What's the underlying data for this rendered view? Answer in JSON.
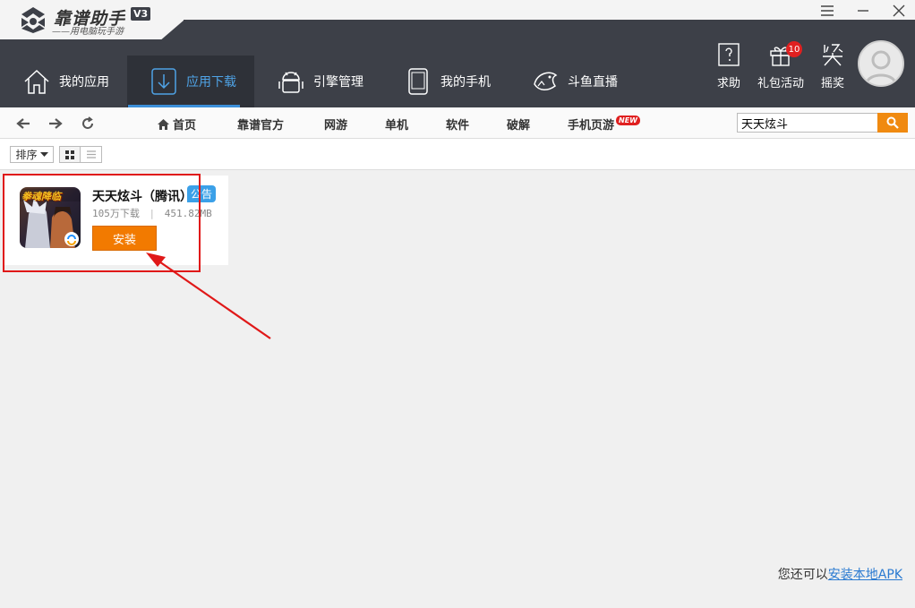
{
  "app": {
    "title": "靠谱助手",
    "version": "V3",
    "subtitle": "——用电脑玩手游"
  },
  "main_nav": [
    {
      "label": "我的应用",
      "icon": "home-icon"
    },
    {
      "label": "应用下载",
      "icon": "download-icon",
      "active": true
    },
    {
      "label": "引擎管理",
      "icon": "android-icon"
    },
    {
      "label": "我的手机",
      "icon": "phone-icon"
    },
    {
      "label": "斗鱼直播",
      "icon": "douyu-fish-icon"
    }
  ],
  "right_tools": [
    {
      "label": "求助",
      "icon": "help-book-icon"
    },
    {
      "label": "礼包活动",
      "icon": "gift-icon",
      "badge": "10"
    },
    {
      "label": "摇奖",
      "icon": "lottery-icon"
    }
  ],
  "categories": {
    "home": "首页",
    "official": "靠谱官方",
    "online": "网游",
    "single": "单机",
    "software": "软件",
    "crack": "破解",
    "webgame": "手机页游",
    "new_badge": "NEW"
  },
  "search": {
    "value": "天天炫斗"
  },
  "toolbar": {
    "sort_label": "排序"
  },
  "app_card": {
    "name": "天天炫斗（腾讯）",
    "tag": "公告",
    "downloads": "105万下载",
    "size": "451.82MB",
    "install_label": "安装",
    "icon_text": "拳魂降临"
  },
  "footer": {
    "prefix": "您还可以",
    "link": "安装本地APK"
  },
  "colors": {
    "header_bg": "#3d4048",
    "accent_blue": "#3b8fd9",
    "install_orange": "#f27a00",
    "annotation_red": "#e01818"
  }
}
